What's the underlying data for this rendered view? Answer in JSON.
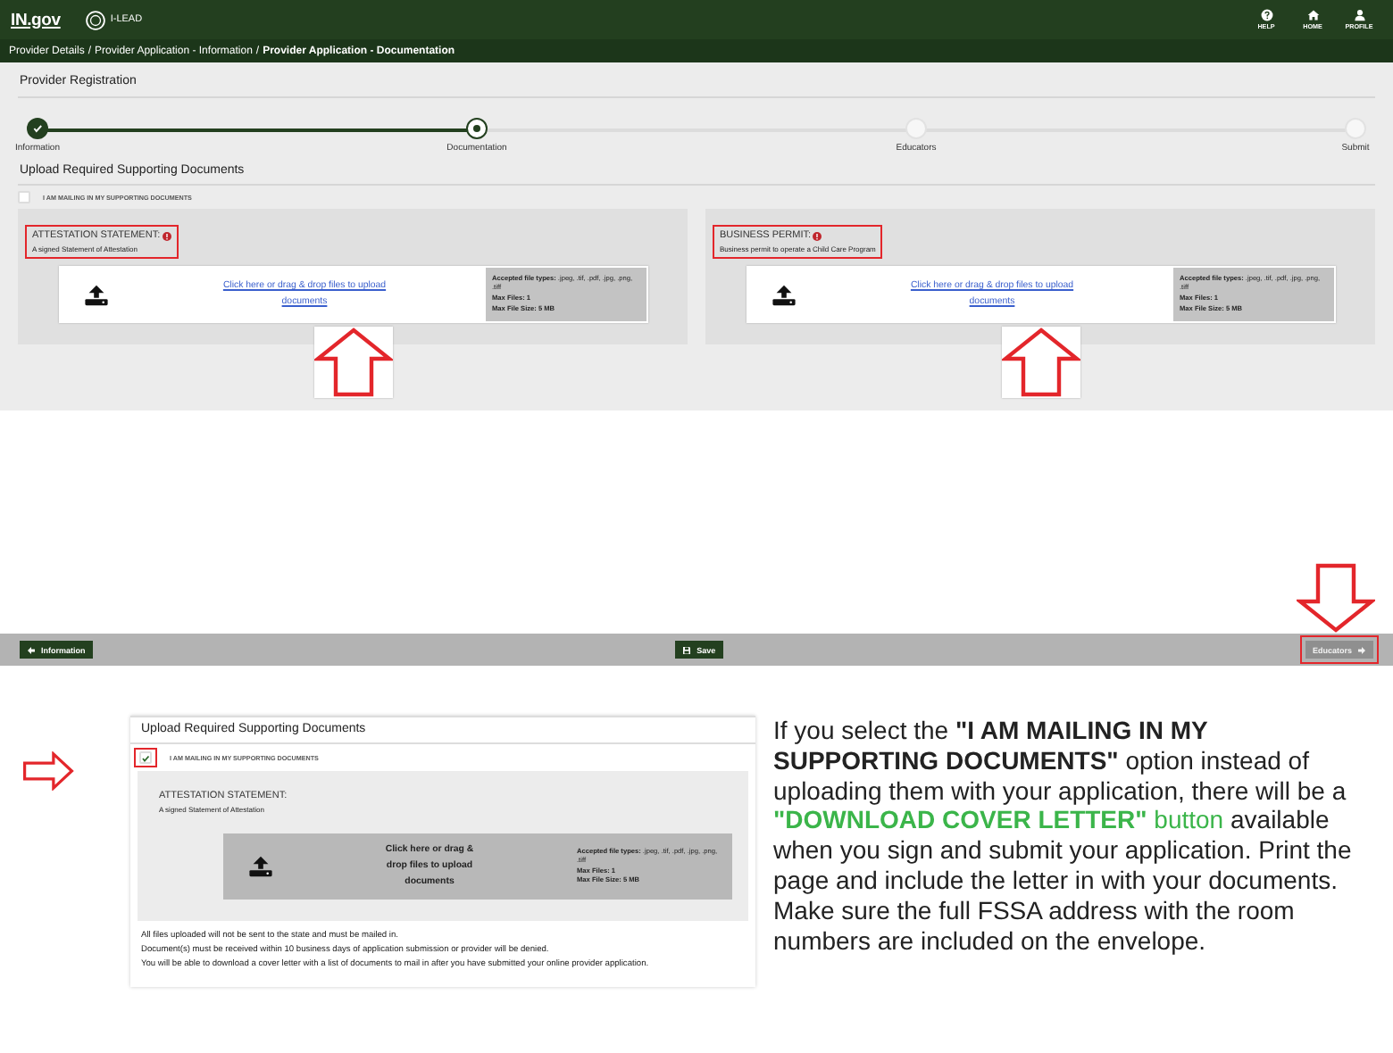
{
  "header": {
    "logo": "IN.gov",
    "app_name": "I-LEAD",
    "actions": [
      {
        "kind": "help",
        "label": "HELP"
      },
      {
        "kind": "home",
        "label": "HOME"
      },
      {
        "kind": "profile",
        "label": "PROFILE"
      }
    ]
  },
  "breadcrumb": [
    {
      "label": "Provider Details",
      "current": false
    },
    {
      "separator": "/",
      "label": "Provider Application - Information",
      "current": false
    },
    {
      "separator": "/",
      "label": "Provider Application - Documentation",
      "current": true
    }
  ],
  "page_title": "Provider Registration",
  "steps": [
    {
      "label": "Information",
      "completed": true,
      "selected": false
    },
    {
      "label": "Documentation",
      "completed": false,
      "selected": true
    },
    {
      "label": "Educators",
      "completed": false,
      "selected": false
    },
    {
      "label": "Submit",
      "completed": false,
      "selected": false
    }
  ],
  "section_title": "Upload Required Supporting Documents",
  "mailing_option": {
    "label": "I AM MAILING IN MY SUPPORTING DOCUMENTS",
    "checked": false
  },
  "documents": [
    {
      "title": "ATTESTATION STATEMENT:",
      "required": true,
      "description": "A signed Statement of Attestation",
      "highlighted": true,
      "arrow": true,
      "upload": {
        "prompt": "Click here or drag & drop files to upload documents",
        "disabled": false,
        "types": "**Accepted file types:** .jpeg, .tif, .pdf, .jpg, .png, .tiff",
        "max_files": "Max Files: 1",
        "max_size": "Max File Size: 5 MB"
      }
    },
    {
      "title": "BUSINESS PERMIT:",
      "required": true,
      "description": "Business permit to operate a Child Care Program",
      "highlighted": true,
      "arrow": true,
      "upload": {
        "prompt": "Click here or drag & drop files to upload documents",
        "disabled": false,
        "types": "**Accepted file types:** .jpeg, .tif, .pdf, .jpg, .png, .tiff",
        "max_files": "Max Files: 1",
        "max_size": "Max File Size: 5 MB"
      }
    }
  ],
  "footer": [
    {
      "kind": "back",
      "label": "Information",
      "disabled": false,
      "highlighted": false,
      "arrow": false
    },
    {
      "kind": "save",
      "label": "Save",
      "disabled": false,
      "highlighted": false,
      "arrow": false
    },
    {
      "kind": "next",
      "label": "Educators",
      "disabled": true,
      "highlighted": true,
      "arrow": true
    }
  ],
  "example": {
    "section_title": "Upload Required Supporting Documents",
    "mailing_option": {
      "label": "I AM MAILING IN MY SUPPORTING DOCUMENTS",
      "checked": true,
      "highlighted": true,
      "arrow": true
    },
    "document": {
      "title": "ATTESTATION STATEMENT:",
      "description": "A signed Statement of Attestation",
      "upload": {
        "prompt": "Click here or drag & drop files to upload documents",
        "disabled": true,
        "types": "**Accepted file types:** .jpeg, .tif, .pdf, .jpg, .png, .tiff",
        "max_files": "Max Files: 1",
        "max_size": "Max File Size: 5 MB"
      }
    },
    "notes": [
      "All files uploaded will not be sent to the state and must be mailed in.",
      "Document(s) must be received within 10 business days of application submission or provider will be denied.",
      "You will be able to download a cover letter with a list of documents to mail in after you have submitted your online provider application."
    ]
  },
  "explanation": [
    {
      "kind": "plain",
      "text": "If you select the "
    },
    {
      "kind": "bold",
      "text": "\"I AM MAILING IN MY SUPPORTING DOCUMENTS\""
    },
    {
      "kind": "plain",
      "text": " option instead of uploading them with your application, there will be a "
    },
    {
      "kind": "greenbold",
      "text": "\"DOWNLOAD COVER LETTER\""
    },
    {
      "kind": "green",
      "text": " button"
    },
    {
      "kind": "plain",
      "text": " available when you sign and submit your application. Print the page and include the letter in with your documents. Make sure the full FSSA address with the room numbers are included on the envelope."
    }
  ]
}
